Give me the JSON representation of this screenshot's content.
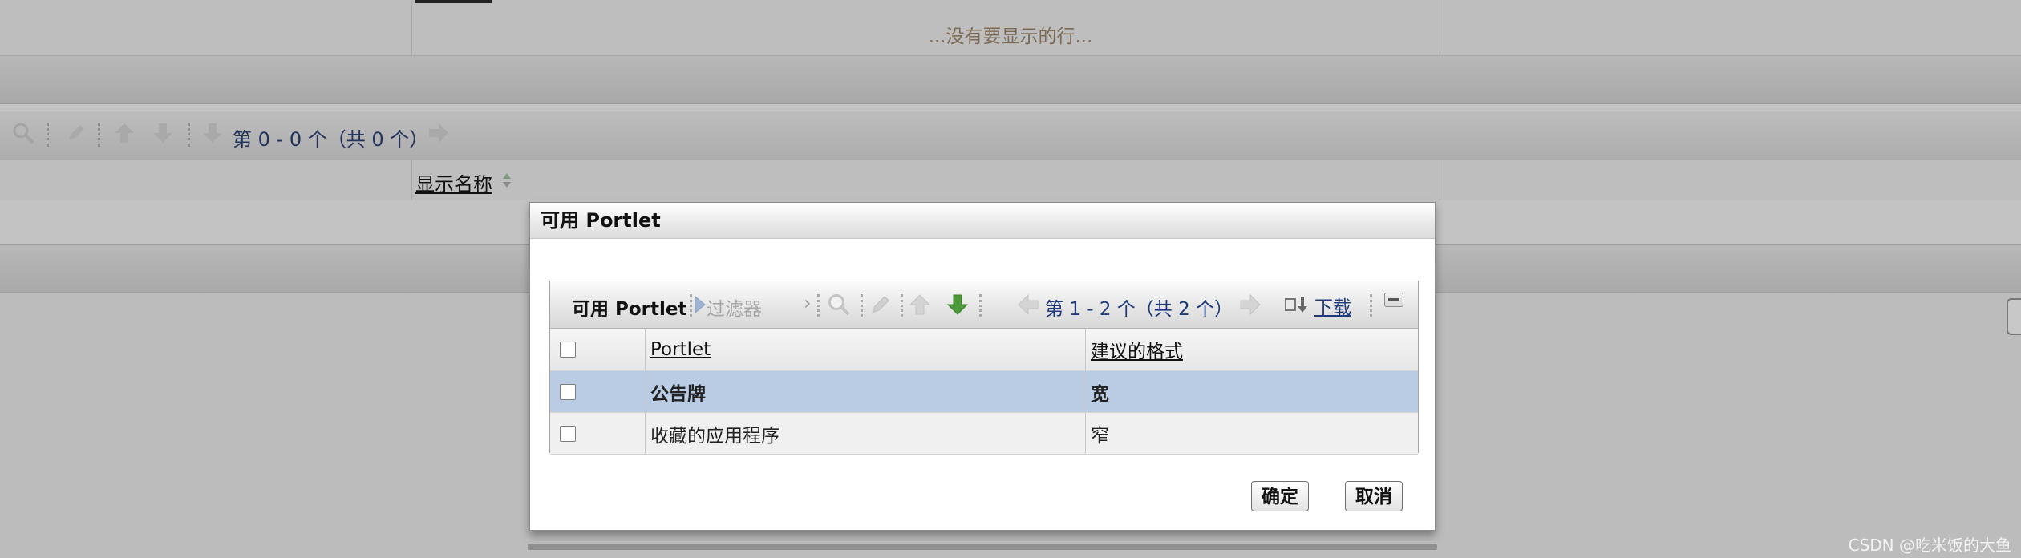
{
  "background": {
    "empty_message": "...没有要显示的行...",
    "pager_text": "第 0 - 0 个（共 0 个）",
    "column_header": "显示名称"
  },
  "dialog": {
    "title": "可用 Portlet",
    "panel": {
      "title": "可用 Portlet",
      "filter_label": "过滤器",
      "pager_text": "第 1 - 2 个（共 2 个）",
      "download_label": "下载",
      "icons": [
        "filter-icon",
        "search-icon",
        "edit-icon",
        "move-up-icon",
        "move-down-icon",
        "previous-page-icon",
        "next-page-icon",
        "download-icon",
        "minimize-icon"
      ]
    },
    "table": {
      "headers": [
        "Portlet",
        "建议的格式"
      ],
      "rows": [
        {
          "portlet": "公告牌",
          "format": "宽",
          "selected": true
        },
        {
          "portlet": "收藏的应用程序",
          "format": "窄",
          "selected": false
        }
      ]
    },
    "ok_label": "确定",
    "cancel_label": "取消"
  },
  "watermark": "CSDN @吃米饭的大鱼",
  "colors": {
    "selected_row": "#b9cce4",
    "link": "#1f3b7a",
    "overlay": "#bcbcbc"
  }
}
